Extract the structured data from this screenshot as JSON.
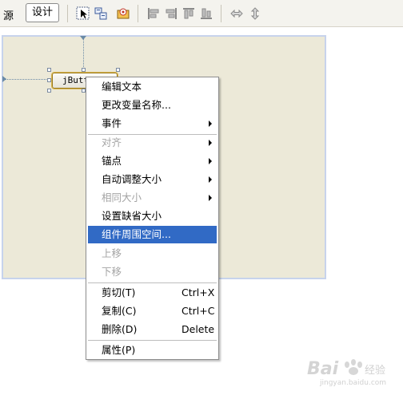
{
  "toolbar": {
    "source_tab": "源",
    "design_tab": "设计"
  },
  "canvas": {
    "component_label": "jButton1"
  },
  "context_menu": {
    "items": [
      {
        "label": "编辑文本",
        "enabled": true
      },
      {
        "label": "更改变量名称...",
        "enabled": true
      },
      {
        "label": "事件",
        "enabled": true,
        "submenu": true
      },
      {
        "label": "对齐",
        "enabled": false,
        "submenu": true
      },
      {
        "label": "锚点",
        "enabled": true,
        "submenu": true
      },
      {
        "label": "自动调整大小",
        "enabled": true,
        "submenu": true
      },
      {
        "label": "相同大小",
        "enabled": false,
        "submenu": true
      },
      {
        "label": "设置缺省大小",
        "enabled": true
      },
      {
        "label": "组件周围空间...",
        "enabled": true,
        "highlighted": true
      },
      {
        "label": "上移",
        "enabled": false
      },
      {
        "label": "下移",
        "enabled": false
      },
      {
        "label": "剪切(T)",
        "shortcut": "Ctrl+X",
        "enabled": true
      },
      {
        "label": "复制(C)",
        "shortcut": "Ctrl+C",
        "enabled": true
      },
      {
        "label": "删除(D)",
        "shortcut": "Delete",
        "enabled": true
      },
      {
        "label": "属性(P)",
        "enabled": true
      }
    ]
  },
  "colors": {
    "highlight": "#316ac5",
    "canvas_bg": "#ece9d8",
    "disabled_text": "#a4a4a4"
  },
  "watermark": {
    "brand": "Bai 经验",
    "url": "jingyan.baidu.com"
  }
}
